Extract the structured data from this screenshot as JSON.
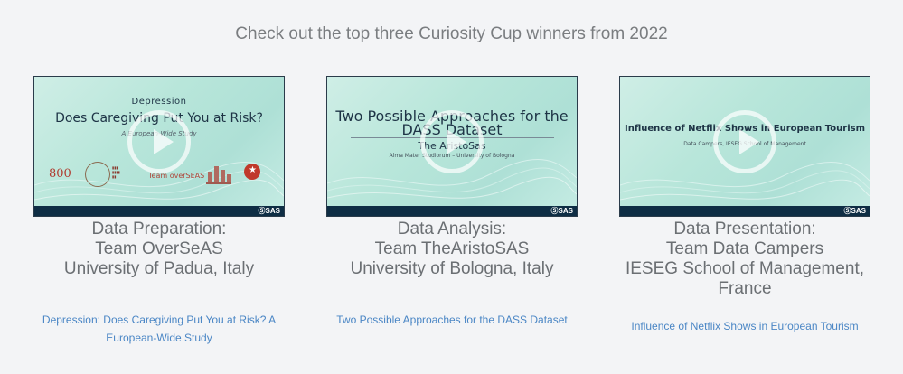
{
  "heading": "Check out the top three Curiosity Cup winners from 2022",
  "brand_label": "ⓈSAS",
  "cards": [
    {
      "slide": {
        "line1": "Depression",
        "line2": "Does Caregiving Put You at Risk?",
        "line3": "A European-Wide Study",
        "logo_800": "800",
        "team_logo": "Team overSEAS"
      },
      "caption": [
        "Data Preparation:",
        "Team OverSeAS",
        "University of Padua, Italy"
      ],
      "link": "Depression: Does Caregiving Put You at Risk? A European-Wide Study"
    },
    {
      "slide": {
        "line1": "Two Possible Approaches for the DASS Dataset",
        "line2": "The AristoSas",
        "line3": "Alma Mater Studiorum – University of Bologna"
      },
      "caption": [
        "Data Analysis:",
        "Team TheAristoSAS",
        "University of Bologna, Italy"
      ],
      "link": "Two Possible Approaches for the DASS Dataset"
    },
    {
      "slide": {
        "line1": "Influence of Netflix Shows in European Tourism",
        "line2": "Data Campers, IESEG School of Management"
      },
      "caption": [
        "Data Presentation:",
        "Team Data Campers",
        "IESEG School of Management,",
        "France"
      ],
      "link": "Influence of Netflix Shows in European Tourism"
    }
  ],
  "colors": {
    "background": "#f3f4f6",
    "heading_text": "#7a7d80",
    "caption_text": "#6b6f73",
    "link_text": "#4a86c5",
    "thumb_bar": "#0e2d44"
  },
  "icons": [
    "play-icon",
    "sas-logo"
  ]
}
